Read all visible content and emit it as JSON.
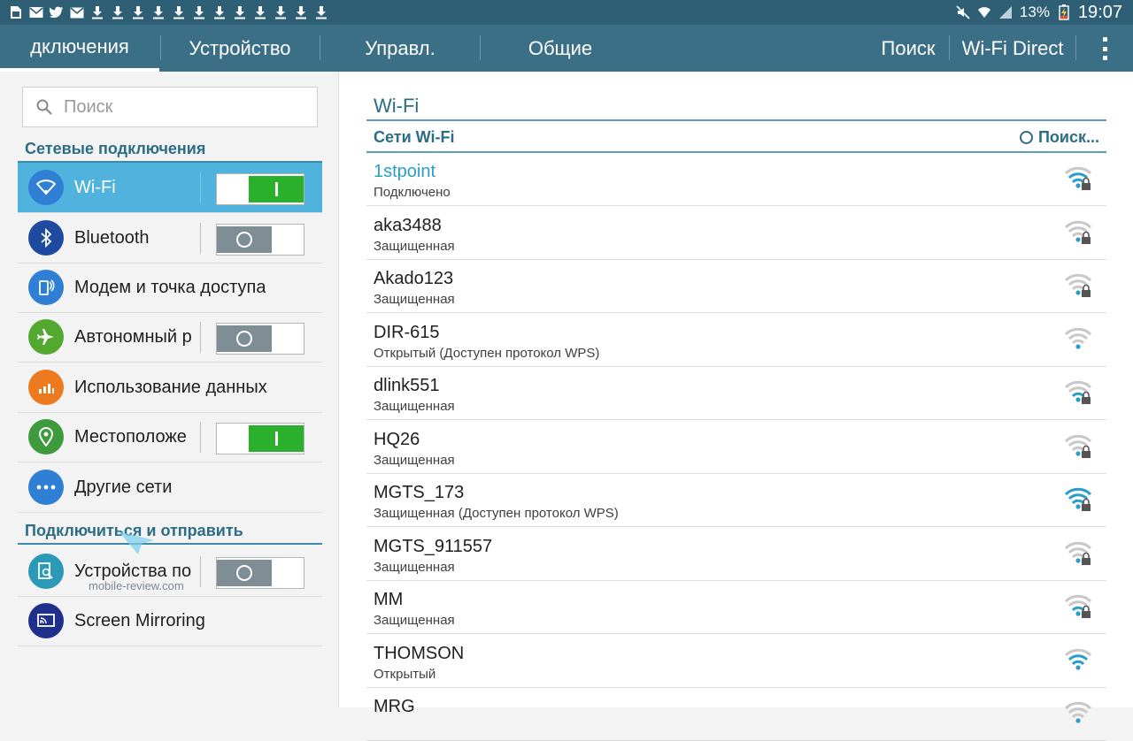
{
  "status_bar": {
    "left_icons": [
      "sim-card-icon",
      "mail-icon",
      "twitter-icon",
      "gmail-icon",
      "download-icon",
      "download-icon",
      "download-icon",
      "download-icon",
      "download-icon",
      "download-icon",
      "download-icon",
      "download-icon",
      "download-icon",
      "download-icon",
      "download-icon",
      "download-icon"
    ],
    "battery": "13%",
    "time": "19:07"
  },
  "tabs": [
    {
      "label": "дключения"
    },
    {
      "label": "Устройство"
    },
    {
      "label": "Управл."
    },
    {
      "label": "Общие"
    }
  ],
  "actions": {
    "search_label": "Поиск",
    "wifi_direct_label": "Wi-Fi Direct"
  },
  "sidebar": {
    "search_placeholder": "Поиск",
    "section1_title": "Сетевые подключения",
    "section2_title": "Подключиться и отправить",
    "items": [
      {
        "label": "Wi-Fi",
        "icon": "wifi-icon",
        "color": "#2f7fd4",
        "toggle": "on"
      },
      {
        "label": "Bluetooth",
        "icon": "bluetooth-icon",
        "color": "#1e4aa0",
        "toggle": "off"
      },
      {
        "label": "Модем и точка доступа",
        "icon": "hotspot-icon",
        "color": "#2f7fd4",
        "toggle": null
      },
      {
        "label": "Автономный р",
        "icon": "airplane-icon",
        "color": "#53a82f",
        "toggle": "off"
      },
      {
        "label": "Использование данных",
        "icon": "data-usage-icon",
        "color": "#ee7a1f",
        "toggle": null
      },
      {
        "label": "Местоположе",
        "icon": "location-icon",
        "color": "#3d9a3d",
        "toggle": "on"
      },
      {
        "label": "Другие сети",
        "icon": "more-networks-icon",
        "color": "#2f7fd4",
        "toggle": null
      },
      {
        "label": "Устройства по",
        "icon": "nearby-devices-icon",
        "color": "#2a9ab8",
        "toggle": "off"
      },
      {
        "label": "Screen Mirroring",
        "icon": "screen-mirroring-icon",
        "color": "#1e2f8c",
        "toggle": null
      }
    ],
    "watermark": "mobile-review.com"
  },
  "wifi": {
    "title": "Wi-Fi",
    "subheading": "Сети Wi-Fi",
    "scan_label": "Поиск...",
    "networks": [
      {
        "name": "1stpoint",
        "status": "Подключено",
        "connected": true,
        "locked": true,
        "strength": 3
      },
      {
        "name": "aka3488",
        "status": "Защищенная",
        "connected": false,
        "locked": true,
        "strength": 1
      },
      {
        "name": "Akado123",
        "status": "Защищенная",
        "connected": false,
        "locked": true,
        "strength": 1
      },
      {
        "name": "DIR-615",
        "status": "Открытый (Доступен протокол WPS)",
        "connected": false,
        "locked": false,
        "strength": 1
      },
      {
        "name": "dlink551",
        "status": "Защищенная",
        "connected": false,
        "locked": true,
        "strength": 2
      },
      {
        "name": "HQ26",
        "status": "Защищенная",
        "connected": false,
        "locked": true,
        "strength": 1
      },
      {
        "name": "MGTS_173",
        "status": "Защищенная (Доступен протокол WPS)",
        "connected": false,
        "locked": true,
        "strength": 4
      },
      {
        "name": "MGTS_911557",
        "status": "Защищенная",
        "connected": false,
        "locked": true,
        "strength": 1
      },
      {
        "name": "MM",
        "status": "Защищенная",
        "connected": false,
        "locked": true,
        "strength": 2
      },
      {
        "name": "THOMSON",
        "status": "Открытый",
        "connected": false,
        "locked": false,
        "strength": 3
      },
      {
        "name": "MRG",
        "status": "",
        "connected": false,
        "locked": false,
        "strength": 1
      }
    ]
  }
}
